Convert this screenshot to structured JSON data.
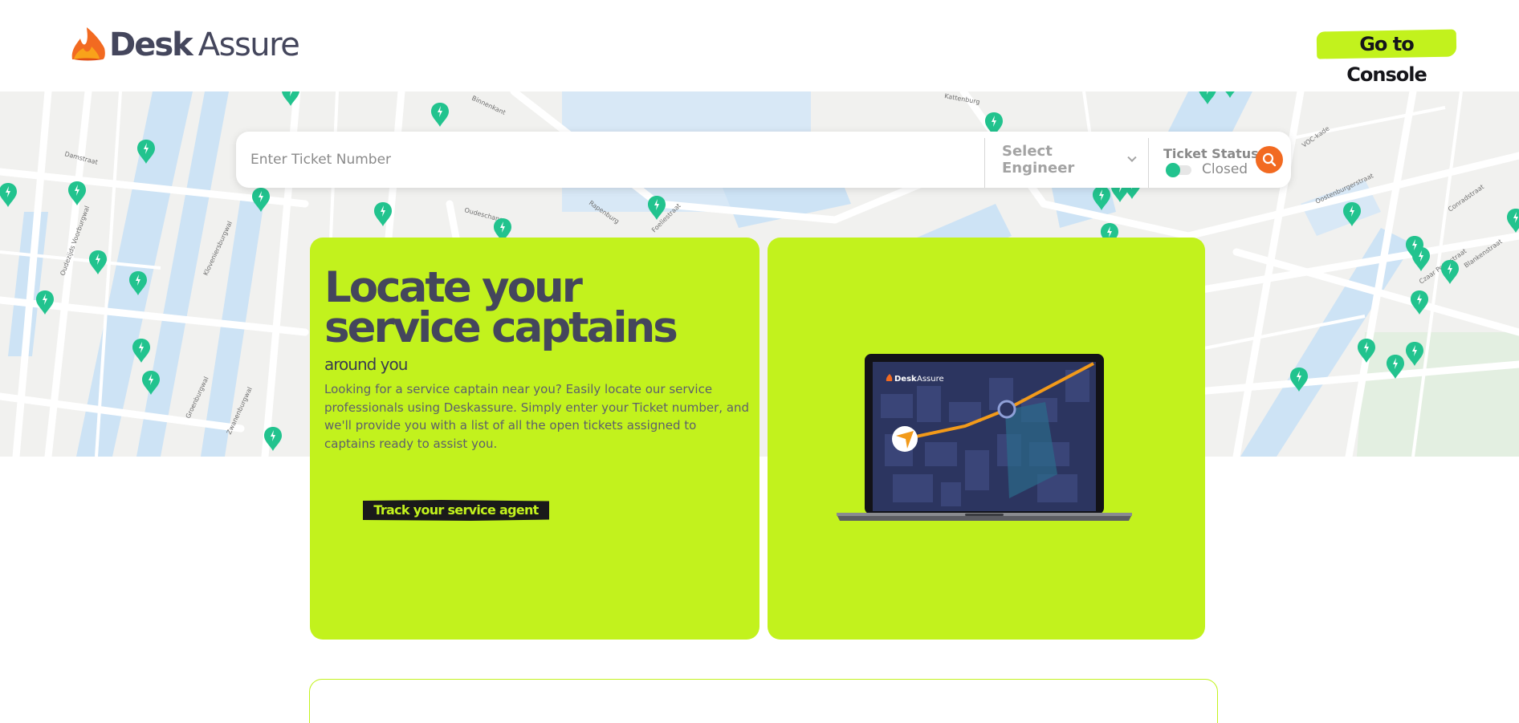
{
  "header": {
    "logo_desk": "Desk",
    "logo_assure": "Assure",
    "console_button": "Go to Console"
  },
  "search": {
    "ticket_placeholder": "Enter Ticket Number",
    "engineer_select": "Select Engineer",
    "ticket_status_title": "Ticket Status",
    "ticket_status_value": "Closed"
  },
  "hero": {
    "title": "Locate your service captains",
    "subtitle": "around you",
    "description": "Looking for a service captain near you? Easily locate our service professionals using Deskassure. Simply enter your Ticket number, and we'll provide you with a list of all the open tickets assigned to captains ready to assist you.",
    "track_button": "Track your service agent"
  },
  "laptop_screen": {
    "logo_desk": "Desk",
    "logo_assure": "Assure"
  },
  "map": {
    "street_labels": [
      "Damstraat",
      "Binnenkant",
      "Kattenburg",
      "Oudezijds Voorburgwal",
      "Kloveniersburgwal",
      "Groenburgwal",
      "Zwanenburgwal",
      "Rapenburg",
      "Foeliestraat",
      "VOC-kade",
      "Oostenburgerstraat",
      "Conradstraat",
      "Czaar Peterstraat",
      "Blankenstraat",
      "Oudeschans"
    ]
  },
  "colors": {
    "accent_lime": "#c2f21d",
    "text_dark": "#44465c",
    "pin_green": "#22c38e",
    "search_orange": "#f26a21"
  }
}
